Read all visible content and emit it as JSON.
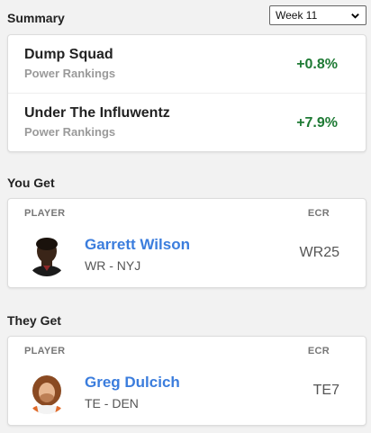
{
  "summary": {
    "title": "Summary",
    "week_select": "Week 11",
    "rows": [
      {
        "team": "Dump Squad",
        "sub": "Power Rankings",
        "delta": "+0.8%"
      },
      {
        "team": "Under The Influwentz",
        "sub": "Power Rankings",
        "delta": "+7.9%"
      }
    ]
  },
  "you_get": {
    "title": "You Get",
    "col_player": "PLAYER",
    "col_ecr": "ECR",
    "player": {
      "name": "Garrett Wilson",
      "pos": "WR - NYJ",
      "ecr": "WR25"
    }
  },
  "they_get": {
    "title": "They Get",
    "col_player": "PLAYER",
    "col_ecr": "ECR",
    "player": {
      "name": "Greg Dulcich",
      "pos": "TE - DEN",
      "ecr": "TE7"
    }
  },
  "colors": {
    "positive": "#1e7a34",
    "link": "#3b7ddd"
  }
}
